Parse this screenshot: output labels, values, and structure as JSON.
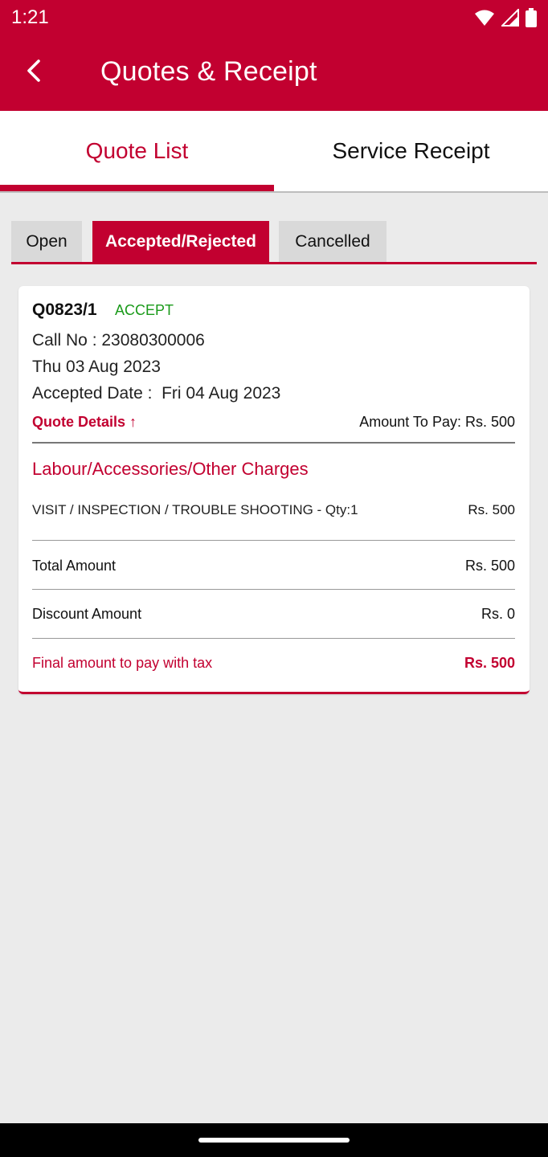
{
  "status_bar": {
    "time": "1:21",
    "icons": [
      "wifi-icon",
      "signal-icon",
      "battery-icon"
    ]
  },
  "app_bar": {
    "title": "Quotes & Receipt",
    "back_icon": "chevron-left-icon"
  },
  "tabs": [
    {
      "label": "Quote List",
      "selected": true
    },
    {
      "label": "Service Receipt",
      "selected": false
    }
  ],
  "subtabs": [
    {
      "label": "Open",
      "selected": false
    },
    {
      "label": "Accepted/Rejected",
      "selected": true
    },
    {
      "label": "Cancelled",
      "selected": false
    }
  ],
  "quote": {
    "number": "Q0823/1",
    "status": "ACCEPT",
    "call_no": "Call No : 23080300006",
    "date": "Thu 03 Aug 2023",
    "accepted_date": "Accepted Date :  Fri 04 Aug 2023",
    "details_link": "Quote Details ↑",
    "amount_to_pay": "Amount To Pay: Rs. 500",
    "charges_heading": "Labour/Accessories/Other Charges",
    "line_items": [
      {
        "description": "VISIT / INSPECTION / TROUBLE SHOOTING - Qty:1",
        "amount": "Rs. 500"
      }
    ],
    "total_label": "Total Amount",
    "total_value": "Rs. 500",
    "discount_label": "Discount Amount",
    "discount_value": "Rs. 0",
    "final_label": "Final amount to pay with tax",
    "final_value": "Rs. 500"
  },
  "colors": {
    "brand": "#c20030",
    "accept_status": "#1a9a1a",
    "background": "#ebebeb"
  }
}
